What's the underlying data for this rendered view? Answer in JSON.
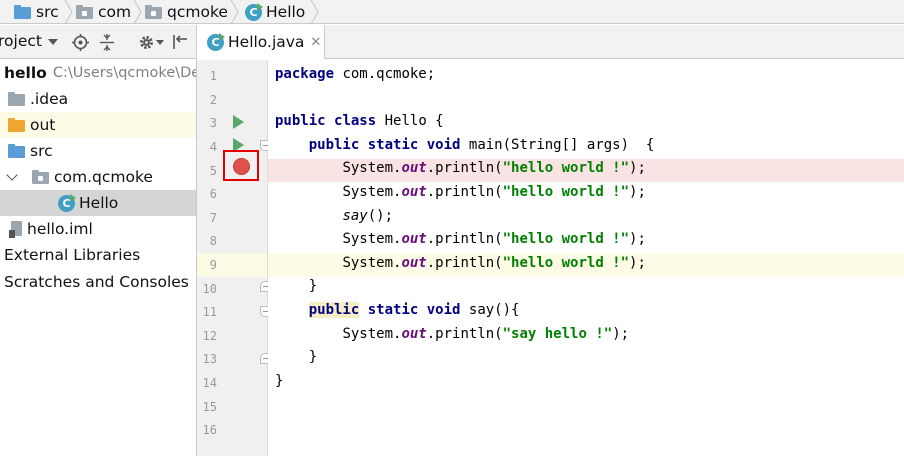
{
  "breadcrumb": {
    "items": [
      {
        "label": "src",
        "icon": "folder-icon"
      },
      {
        "label": "com",
        "icon": "package-icon"
      },
      {
        "label": "qcmoke",
        "icon": "package-icon"
      },
      {
        "label": "Hello",
        "icon": "java-class-icon"
      }
    ]
  },
  "project_panel": {
    "title": "roject",
    "toolbar_icons": [
      "locate-icon",
      "collapse-all-icon",
      "settings-icon",
      "hide-icon"
    ]
  },
  "tree": {
    "root": {
      "label": "hello",
      "path": "C:\\Users\\qcmoke\\De"
    },
    "items": [
      {
        "label": ".idea"
      },
      {
        "label": "out"
      },
      {
        "label": "src"
      },
      {
        "label": "com.qcmoke"
      },
      {
        "label": "Hello"
      },
      {
        "label": "hello.iml"
      },
      {
        "label": "External Libraries"
      },
      {
        "label": "Scratches and Consoles"
      }
    ]
  },
  "editor": {
    "tab_label": "Hello.java",
    "line_numbers": [
      "1",
      "2",
      "3",
      "4",
      "5",
      "6",
      "7",
      "8",
      "9",
      "10",
      "11",
      "12",
      "13",
      "14",
      "15",
      "16"
    ],
    "breakpoint_line": 5,
    "caret_line": 9,
    "colors": {
      "keyword": "#000080",
      "string": "#008000",
      "field": "#660e7a",
      "breakpoint": "#e0504c",
      "run": "#59a869"
    },
    "code": {
      "l1_kw": "package",
      "l1_rest": " com.qcmoke;",
      "l3_kw1": "public",
      "l3_kw2": "class",
      "l3_rest": " Hello {",
      "l4_kw1": "public",
      "l4_kw2": "static",
      "l4_kw3": "void",
      "l4_rest": " main(String[] args)  {",
      "sys": "System.",
      "out": "out",
      "println_open": ".println(",
      "hello_world": "\"hello world !\"",
      "close": ");",
      "say_call": "say",
      "say_rest": "();",
      "l10": "}",
      "l11_kw1": "public",
      "l11_kw2": "static",
      "l11_kw3": "void",
      "l11_rest": " say(){",
      "say_hello": "\"say hello !\"",
      "l13": "}",
      "l14": "}"
    }
  }
}
